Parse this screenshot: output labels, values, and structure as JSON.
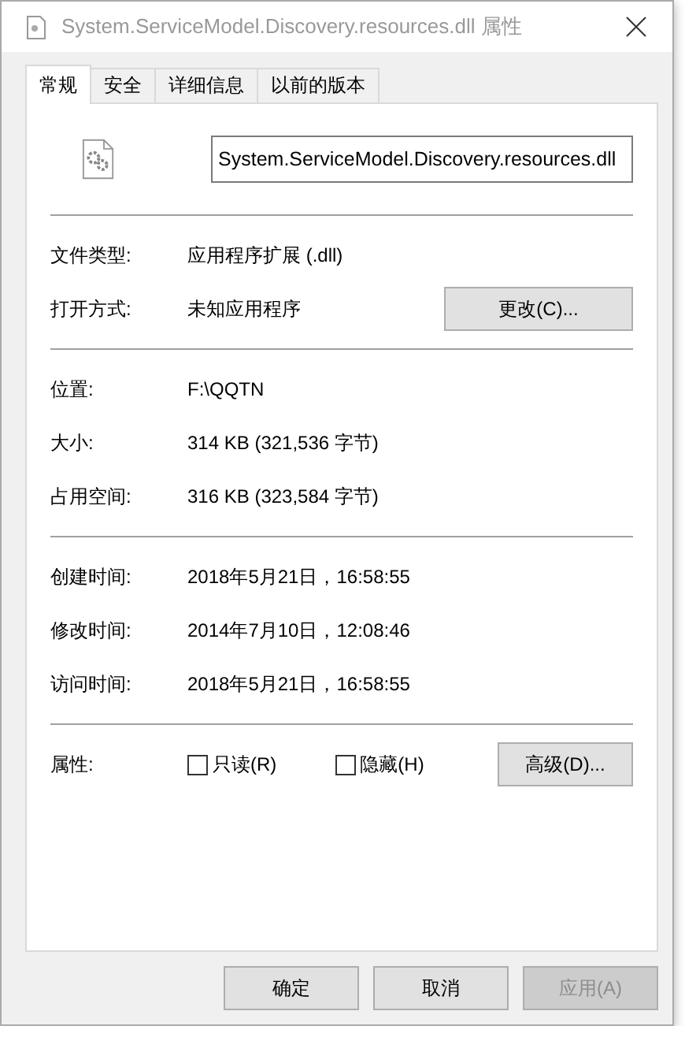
{
  "window": {
    "title": "System.ServiceModel.Discovery.resources.dll 属性"
  },
  "tabs": [
    {
      "label": "常规",
      "selected": true
    },
    {
      "label": "安全",
      "selected": false
    },
    {
      "label": "详细信息",
      "selected": false
    },
    {
      "label": "以前的版本",
      "selected": false
    }
  ],
  "file_name": "System.ServiceModel.Discovery.resources.dll",
  "sections": [
    [
      {
        "label": "文件类型:",
        "value": "应用程序扩展 (.dll)"
      },
      {
        "label": "打开方式:",
        "value": "未知应用程序",
        "button": "更改(C)..."
      }
    ],
    [
      {
        "label": "位置:",
        "value": "F:\\QQTN"
      },
      {
        "label": "大小:",
        "value": "314 KB (321,536 字节)"
      },
      {
        "label": "占用空间:",
        "value": "316 KB (323,584 字节)"
      }
    ],
    [
      {
        "label": "创建时间:",
        "value": "2018年5月21日，16:58:55"
      },
      {
        "label": "修改时间:",
        "value": "2014年7月10日，12:08:46"
      },
      {
        "label": "访问时间:",
        "value": "2018年5月21日，16:58:55"
      }
    ]
  ],
  "attributes": {
    "label": "属性:",
    "options": [
      {
        "label": "只读(R)",
        "checked": false
      },
      {
        "label": "隐藏(H)",
        "checked": false
      }
    ],
    "button": "高级(D)..."
  },
  "buttons": [
    {
      "label": "确定",
      "disabled": false
    },
    {
      "label": "取消",
      "disabled": false
    },
    {
      "label": "应用(A)",
      "disabled": true
    }
  ]
}
